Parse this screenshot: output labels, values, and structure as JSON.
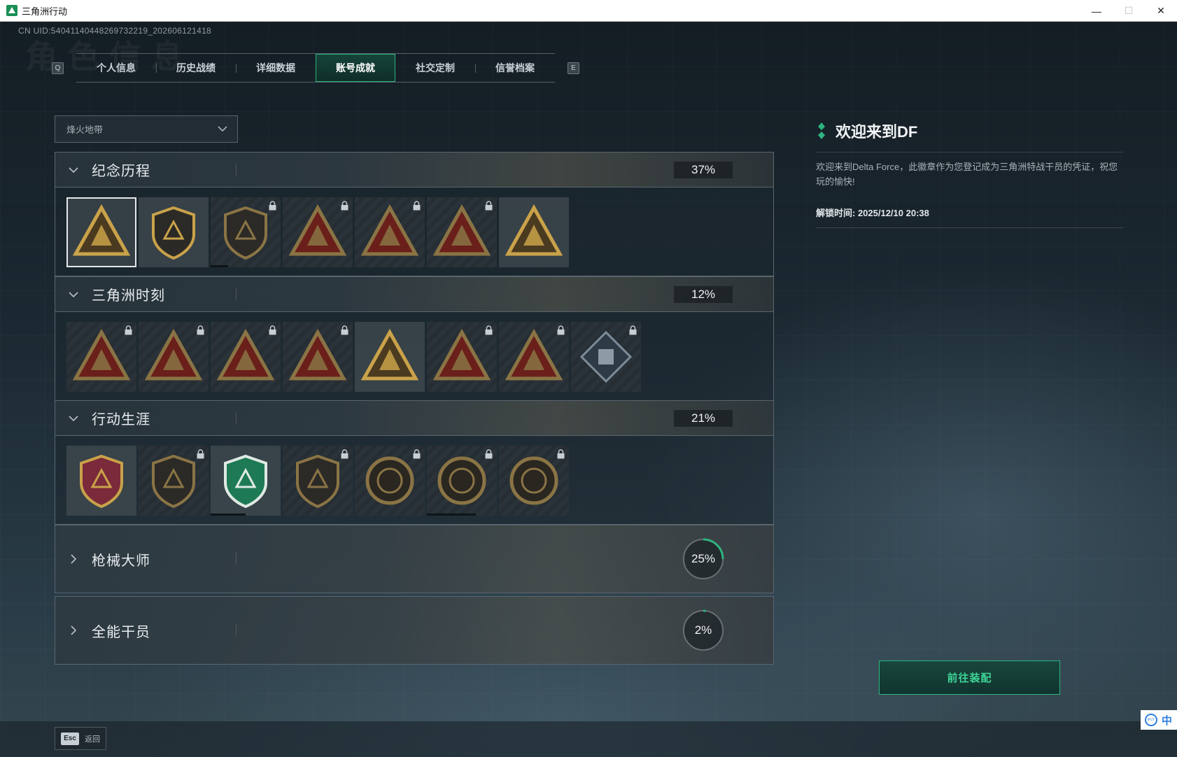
{
  "window": {
    "title": "三角洲行动"
  },
  "uid": "CN UID:5404114044826973221​9_202606121418",
  "watermark": "角色信息",
  "tabs": {
    "prev_key": "Q",
    "next_key": "E",
    "items": [
      {
        "label": "个人信息"
      },
      {
        "label": "历史战绩"
      },
      {
        "label": "详细数据"
      },
      {
        "label": "账号成就",
        "active": true
      },
      {
        "label": "社交定制"
      },
      {
        "label": "信誉档案"
      }
    ]
  },
  "mode_select": {
    "value": "烽火地带"
  },
  "categories": [
    {
      "title": "纪念历程",
      "percent": "37%",
      "expanded": true
    },
    {
      "title": "三角洲时刻",
      "percent": "12%",
      "expanded": true
    },
    {
      "title": "行动生涯",
      "percent": "21%",
      "expanded": true
    },
    {
      "title": "枪械大师",
      "percent": "25%",
      "expanded": false,
      "progress": 0.25
    },
    {
      "title": "全能干员",
      "percent": "2%",
      "expanded": false,
      "progress": 0.02
    }
  ],
  "badge_rows": [
    {
      "badges": [
        {
          "icon": "delta-emblem-icon",
          "locked": false,
          "selected": true
        },
        {
          "icon": "helicopter-emblem-icon",
          "locked": false
        },
        {
          "icon": "shield-emblem-icon",
          "locked": true,
          "progress": 0.25
        },
        {
          "icon": "fire-emblem-icon",
          "locked": true
        },
        {
          "icon": "hooded-figure-emblem-icon",
          "locked": true
        },
        {
          "icon": "crossed-swords-emblem-icon",
          "locked": true
        },
        {
          "icon": "gold-delta-emblem-icon",
          "locked": false
        }
      ]
    },
    {
      "badges": [
        {
          "icon": "robot-triangle-icon",
          "locked": true
        },
        {
          "icon": "soldier-triangle-icon",
          "locked": true
        },
        {
          "icon": "crouching-figure-triangle-icon",
          "locked": true
        },
        {
          "icon": "helmet-triangle-icon",
          "locked": true
        },
        {
          "icon": "squad-triangle-icon",
          "locked": false
        },
        {
          "icon": "beast-triangle-icon",
          "locked": true
        },
        {
          "icon": "fish-triangle-icon",
          "locked": true
        },
        {
          "icon": "cube-diamond-icon",
          "locked": true
        }
      ]
    },
    {
      "badges": [
        {
          "icon": "star-medal-icon",
          "locked": false
        },
        {
          "icon": "dark-shield-icon",
          "locked": true
        },
        {
          "icon": "green-shield-icon",
          "locked": false,
          "progress": 0.5
        },
        {
          "icon": "hex-shield-icon",
          "locked": true
        },
        {
          "icon": "shell-round-icon",
          "locked": true
        },
        {
          "icon": "skull-round-icon",
          "locked": true,
          "progress": 0.7
        },
        {
          "icon": "eye-round-icon",
          "locked": true
        }
      ]
    }
  ],
  "info": {
    "title": "欢迎来到DF",
    "description": "欢迎来到Delta Force，此徽章作为您登记成为三角洲特战干员的凭证，祝您玩的愉快!",
    "unlock_time": "解锁时间: 2025/12/10 20:38"
  },
  "equip_button": "前往装配",
  "esc": {
    "key": "Esc",
    "label": "返回"
  },
  "ime": {
    "lang": "中"
  },
  "colors": {
    "accent": "#2fb37f",
    "accent_text": "#3fd598",
    "gold": "#c9a24a",
    "locked_red": "#6b1f1a"
  }
}
